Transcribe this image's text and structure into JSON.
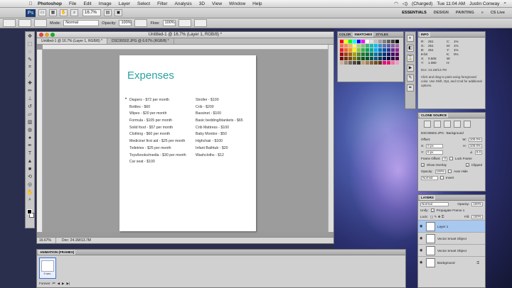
{
  "menubar": {
    "app_name": "Photoshop",
    "items": [
      "File",
      "Edit",
      "Image",
      "Layer",
      "Select",
      "Filter",
      "Analysis",
      "3D",
      "View",
      "Window",
      "Help"
    ],
    "battery": "(Charged)",
    "clock": "Tue 11:04 AM",
    "user": "Justin Conway"
  },
  "appbar": {
    "logo": "Ps",
    "zoom": "16.7%",
    "workspaces": [
      "ESSENTIALS",
      "DESIGN",
      "PAINTING"
    ],
    "more": "»",
    "cslive": "CS Live"
  },
  "optbar": {
    "mode_label": "Mode:",
    "mode_value": "Normal",
    "opacity_label": "Opacity:",
    "opacity_value": "100%",
    "flow_label": "Flow:",
    "flow_value": "100%"
  },
  "document": {
    "window_title": "Untitled-1 @ 16.7% (Layer 1, RGB/8) *",
    "tabs": [
      "Untitled-1 @ 16.7% (Layer 1, RGB/8) *",
      "DSC06502.JPG @ 6.67% (RGB/8) *"
    ],
    "status_zoom": "16.67%",
    "status_doc": "Doc: 24.1M/13.7M",
    "page": {
      "title": "Expenses",
      "col1": [
        "Diapers - $72 per month",
        "Bottles - $60",
        "Wipes - $20 per month",
        "Formula - $105 per month",
        "Solid food - $57 per month",
        "Clothing - $60 per month",
        "Medicine/ first aid - $25 per month",
        "Toiletries - $25 per month",
        "Toys/books/media - $30 per month",
        "Car seat - $100"
      ],
      "col2": [
        "Stroller - $100",
        "Crib - $200",
        "Bassinet - $100",
        "Basic bedding/blankets - $65",
        "Crib Mattress - $100",
        "Baby Monitor - $50",
        "Highchair - $100",
        "Infant Bathtub - $20",
        "Washcloths - $12"
      ]
    }
  },
  "swatches_panel": {
    "tabs": [
      "COLOR",
      "SWATCHES",
      "STYLES"
    ],
    "colors": [
      "#ff0000",
      "#ffff00",
      "#00ff00",
      "#00ffff",
      "#0000ff",
      "#ff00ff",
      "#ffffff",
      "#e0e0e0",
      "#c0c0c0",
      "#a0a0a0",
      "#808080",
      "#606060",
      "#404040",
      "#000000",
      "#f26c4f",
      "#f68e55",
      "#fbaf5d",
      "#fff568",
      "#acd372",
      "#7cc576",
      "#3bb878",
      "#1abbb4",
      "#00bff3",
      "#438ccb",
      "#5574b9",
      "#605ca8",
      "#855fa8",
      "#a763a8",
      "#ed1c24",
      "#f26522",
      "#f7941d",
      "#fff200",
      "#8dc63f",
      "#39b54a",
      "#00a651",
      "#00a99d",
      "#00aeef",
      "#0072bc",
      "#0054a6",
      "#2e3192",
      "#662d91",
      "#92278f",
      "#9e0b0f",
      "#a0410d",
      "#a36209",
      "#aba000",
      "#598527",
      "#1a7b30",
      "#007236",
      "#00746b",
      "#0076a3",
      "#004b80",
      "#003471",
      "#1b1464",
      "#440e62",
      "#630460",
      "#790000",
      "#7b2e00",
      "#7d4900",
      "#827b00",
      "#406618",
      "#005e20",
      "#005826",
      "#005952",
      "#005b7f",
      "#003663",
      "#002157",
      "#0d004c",
      "#32004b",
      "#4b0049",
      "#c7b299",
      "#998675",
      "#736357",
      "#534741",
      "#37302d",
      "#c69c6d",
      "#a67c52",
      "#8c6239",
      "#754c24",
      "#603913",
      "#ec008c",
      "#ed145b",
      "#f06eaa",
      "#f49ac2"
    ]
  },
  "info_panel": {
    "title": "INFO",
    "rows": [
      [
        "R:",
        "251",
        "C:",
        "1%"
      ],
      [
        "G:",
        "251",
        "M:",
        "1%"
      ],
      [
        "B:",
        "251",
        "Y:",
        "1%"
      ],
      [
        "8-bit",
        "",
        "K:",
        "0%"
      ],
      [
        "X:",
        "0.505",
        "W:",
        ""
      ],
      [
        "Y:",
        "1.080",
        "H:",
        ""
      ]
    ],
    "doc": "Doc: 24.1M/13.7M",
    "hint": "Click and drag to paint using foreground color. Use Shift, Opt, and Cmd for additional options."
  },
  "clone_panel": {
    "title": "CLONE SOURCE",
    "source": "DSC06502.JPG : Background",
    "offset_label": "Offset:",
    "x_value": "0 px",
    "y_value": "0 px",
    "w_value": "100.0%",
    "h_value": "100.0%",
    "angle_value": "0.0",
    "frame_offset_label": "Frame Offset:",
    "frame_offset_value": "0",
    "lock_frame": "Lock Frame",
    "show_overlay": "Show Overlay",
    "clipped": "Clipped",
    "opacity_label": "Opacity:",
    "opacity_value": "100%",
    "auto_hide": "Auto Hide",
    "blend": "Normal",
    "invert": "Invert"
  },
  "layers_panel": {
    "title": "LAYERS",
    "blend": "Normal",
    "opacity_label": "Opacity:",
    "opacity_value": "100%",
    "unify_label": "Unify:",
    "propagate": "Propagate Frame 1",
    "lock_label": "Lock:",
    "fill_label": "Fill:",
    "fill_value": "100%",
    "layers": [
      "Layer 1",
      "Vector Smart Object",
      "Vector Smart Object",
      "Background"
    ]
  },
  "animation_panel": {
    "title": "ANIMATION (FRAMES)",
    "frame_delay": "0 sec.",
    "loop": "Forever"
  }
}
